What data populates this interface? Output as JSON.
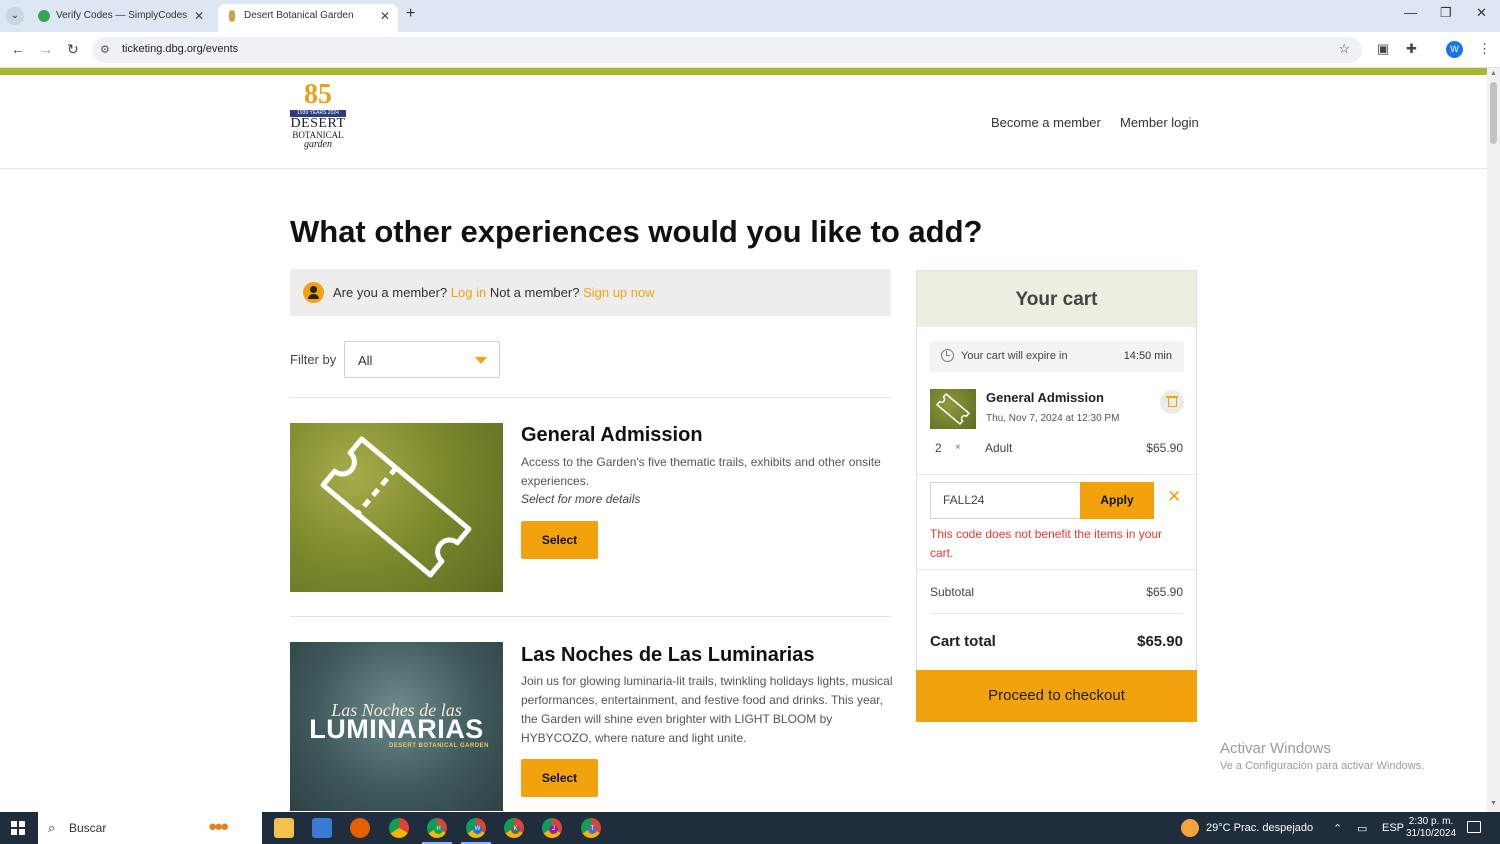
{
  "browser": {
    "tabs": [
      {
        "title": "Verify Codes — SimplyCodes",
        "active": false
      },
      {
        "title": "Desert Botanical Garden",
        "active": true
      }
    ],
    "url": "ticketing.dbg.org/events",
    "profile_initial": "W"
  },
  "header": {
    "logo": {
      "number": "85",
      "years": "1939 YEARS 2024",
      "line1": "DESERT",
      "line2": "BOTANICAL",
      "line3": "garden"
    },
    "links": [
      "Become a member",
      "Member login"
    ]
  },
  "main": {
    "title": "What other experiences would you like to add?",
    "member_bar": {
      "question": "Are you a member?",
      "login_link": "Log in",
      "not_member": "Not a member?",
      "signup_link": "Sign up now"
    },
    "filter": {
      "label": "Filter by",
      "value": "All"
    },
    "events": [
      {
        "title": "General Admission",
        "description": "Access to the Garden's five thematic trails, exhibits and other onsite experiences.",
        "more": "Select for more details",
        "button": "Select"
      },
      {
        "title": "Las Noches de Las Luminarias",
        "description": "Join us for glowing luminaria-lit trails, twinkling holidays lights, musical performances, entertainment, and festive food and drinks. This year, the Garden will shine even brighter with LIGHT BLOOM by HYBYCOZO, where nature and light unite.",
        "button": "Select",
        "image_text": {
          "script": "Las Noches de las",
          "big": "LUMINARIAS",
          "small": "DESERT BOTANICAL GARDEN"
        }
      }
    ]
  },
  "cart": {
    "title": "Your cart",
    "expire_label": "Your cart will expire in",
    "expire_time": "14:50 min",
    "item": {
      "name": "General Admission",
      "date": "Thu, Nov 7, 2024 at 12:30 PM",
      "qty": "2",
      "times": "×",
      "type": "Adult",
      "price": "$65.90"
    },
    "promo": {
      "code": "FALL24",
      "apply_label": "Apply",
      "clear_symbol": "✕",
      "error": "This code does not benefit the items in your cart."
    },
    "subtotal_label": "Subtotal",
    "subtotal": "$65.90",
    "total_label": "Cart total",
    "total": "$65.90",
    "checkout_label": "Proceed to checkout"
  },
  "watermark": {
    "line1": "Activar Windows",
    "line2": "Ve a Configuración para activar Windows."
  },
  "taskbar": {
    "search_placeholder": "Buscar",
    "weather": "29°C  Prac. despejado",
    "lang": "ESP",
    "time": "2:30 p. m.",
    "date": "31/10/2024"
  },
  "colors": {
    "accent": "#f2a20c",
    "brand_green": "#a8b830",
    "error": "#e53935"
  }
}
